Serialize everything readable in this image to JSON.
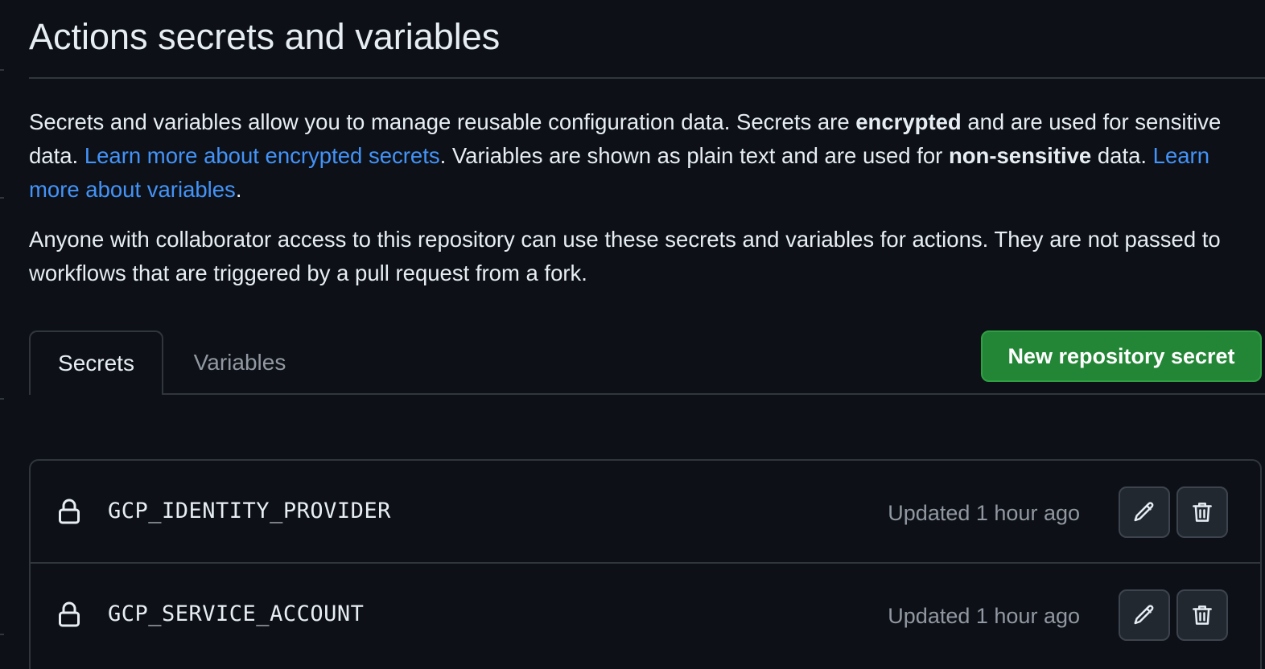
{
  "page": {
    "title": "Actions secrets and variables"
  },
  "description": {
    "p1_text_1": "Secrets and variables allow you to manage reusable configuration data. Secrets are ",
    "p1_bold_1": "encrypted",
    "p1_text_2": " and are used for sensitive data. ",
    "p1_link_1": "Learn more about encrypted secrets",
    "p1_text_3": ". Variables are shown as plain text and are used for ",
    "p1_bold_2": "non-sensitive",
    "p1_text_4": " data. ",
    "p1_link_2": "Learn more about variables",
    "p1_text_5": ".",
    "p2": "Anyone with collaborator access to this repository can use these secrets and variables for actions. They are not passed to workflows that are triggered by a pull request from a fork."
  },
  "tabs": [
    {
      "label": "Secrets",
      "active": true
    },
    {
      "label": "Variables",
      "active": false
    }
  ],
  "new_secret_button": "New repository secret",
  "secrets": [
    {
      "name": "GCP_IDENTITY_PROVIDER",
      "updated": "Updated 1 hour ago"
    },
    {
      "name": "GCP_SERVICE_ACCOUNT",
      "updated": "Updated 1 hour ago"
    }
  ],
  "icons": {
    "lock": "lock-icon",
    "edit": "pencil-icon",
    "delete": "trash-icon"
  },
  "colors": {
    "background": "#0d1117",
    "text": "#e6edf3",
    "muted": "#9198a1",
    "link": "#4493f8",
    "border": "#30363d",
    "primary_button": "#238636"
  }
}
